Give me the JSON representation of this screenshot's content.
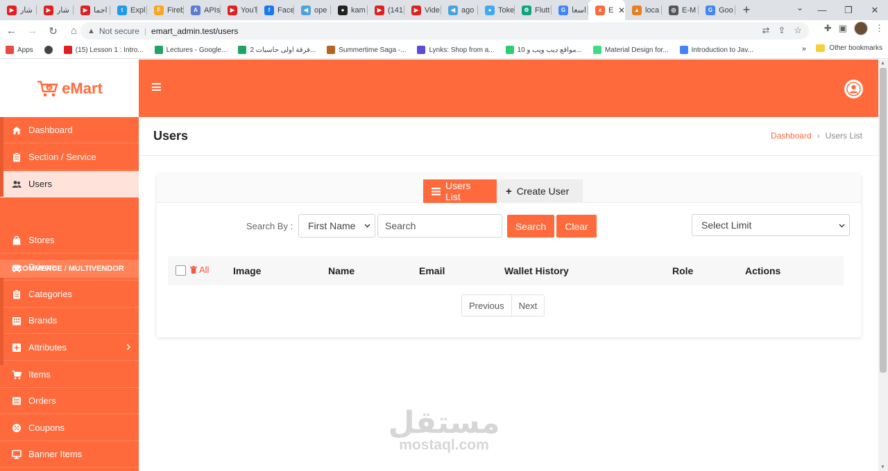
{
  "browser": {
    "tabs": [
      {
        "title": "شار",
        "color": "#e02020",
        "glyph": "▶"
      },
      {
        "title": "شار",
        "color": "#e02020",
        "glyph": "▶"
      },
      {
        "title": "اجما",
        "color": "#e02020",
        "glyph": "▶"
      },
      {
        "title": "Expl",
        "color": "#1d9bf0",
        "glyph": "t"
      },
      {
        "title": "Fireb",
        "color": "#f5a623",
        "glyph": "F"
      },
      {
        "title": "APIs",
        "color": "#5b7bd5",
        "glyph": "A"
      },
      {
        "title": "YouT",
        "color": "#e02020",
        "glyph": "▶"
      },
      {
        "title": "Face",
        "color": "#1877f2",
        "glyph": "f"
      },
      {
        "title": "ope",
        "color": "#4aa3df",
        "glyph": "◀"
      },
      {
        "title": "kam",
        "color": "#222222",
        "glyph": "●"
      },
      {
        "title": "(141",
        "color": "#e02020",
        "glyph": "▶"
      },
      {
        "title": "Vide",
        "color": "#e02020",
        "glyph": "▶"
      },
      {
        "title": "ago",
        "color": "#4aa3df",
        "glyph": "◀"
      },
      {
        "title": "Toke",
        "color": "#3fa9f5",
        "glyph": "●"
      },
      {
        "title": "Flutt",
        "color": "#10a37f",
        "glyph": "⚙"
      },
      {
        "title": "اسعا",
        "color": "#4285f4",
        "glyph": "G"
      },
      {
        "title": "E",
        "color": "#ff6a3d",
        "glyph": "e"
      },
      {
        "title": "loca",
        "color": "#e67e22",
        "glyph": "▲"
      },
      {
        "title": "E-M",
        "color": "#555555",
        "glyph": "◎"
      },
      {
        "title": "Goo",
        "color": "#4285f4",
        "glyph": "G"
      }
    ],
    "active_tab_index": 16,
    "not_secure": "Not secure",
    "url": "emart_admin.test/users",
    "bookmarks": [
      {
        "label": "Apps",
        "color": "#e74c3c"
      },
      {
        "label": "",
        "color": "#444444"
      },
      {
        "label": "(15) Lesson 1 : Intro...",
        "color": "#e02020"
      },
      {
        "label": "Lectures - Google...",
        "color": "#1fa463"
      },
      {
        "label": "فرقة اولى حاسبات 2...",
        "color": "#1fa463"
      },
      {
        "label": "Summertime Saga -...",
        "color": "#b5651d"
      },
      {
        "label": "Lynks: Shop from a...",
        "color": "#5b4bd5"
      },
      {
        "label": "10 مواقع ديب ويب و...",
        "color": "#2ecc71"
      },
      {
        "label": "Material Design for...",
        "color": "#3ddc84"
      },
      {
        "label": "Introduction to Jav...",
        "color": "#4285f4"
      }
    ],
    "bookmarks_more": "»",
    "other_bookmarks": "Other bookmarks"
  },
  "app": {
    "brand": "eMart",
    "sidebar": {
      "items": [
        {
          "label": "Dashboard",
          "icon": "home-icon"
        },
        {
          "label": "Section / Service",
          "icon": "clipboard-icon"
        },
        {
          "label": "Users",
          "icon": "users-icon"
        },
        {
          "label": "Stores",
          "icon": "bag-icon"
        },
        {
          "label": "Drivers",
          "icon": "car-icon"
        },
        {
          "label": "Categories",
          "icon": "clipboard-icon"
        },
        {
          "label": "Brands",
          "icon": "building-icon"
        },
        {
          "label": "Attributes",
          "icon": "plus-square-icon"
        },
        {
          "label": "Items",
          "icon": "cart-icon"
        },
        {
          "label": "Orders",
          "icon": "list-icon"
        },
        {
          "label": "Coupons",
          "icon": "coupon-icon"
        },
        {
          "label": "Banner Items",
          "icon": "monitor-icon"
        }
      ],
      "heading": "ECOMMERCE / MULTIVENDOR",
      "active": "Users"
    },
    "page": {
      "title": "Users",
      "breadcrumb": [
        "Dashboard",
        "Users List"
      ]
    },
    "tabs": {
      "list": "Users List",
      "create": "Create User"
    },
    "search": {
      "label": "Search By :",
      "field_option": "First Name",
      "placeholder": "Search",
      "search_btn": "Search",
      "clear_btn": "Clear",
      "limit_placeholder": "Select Limit"
    },
    "table": {
      "select_all": "All",
      "columns": [
        "Image",
        "Name",
        "Email",
        "Wallet History",
        "Role",
        "Actions"
      ]
    },
    "pagination": {
      "previous": "Previous",
      "next": "Next"
    },
    "watermark": {
      "arabic": "مستقل",
      "latin": "mostaql.com"
    },
    "colors": {
      "primary": "#ff6a3d",
      "active_item_bg": "#ffe3da"
    }
  }
}
